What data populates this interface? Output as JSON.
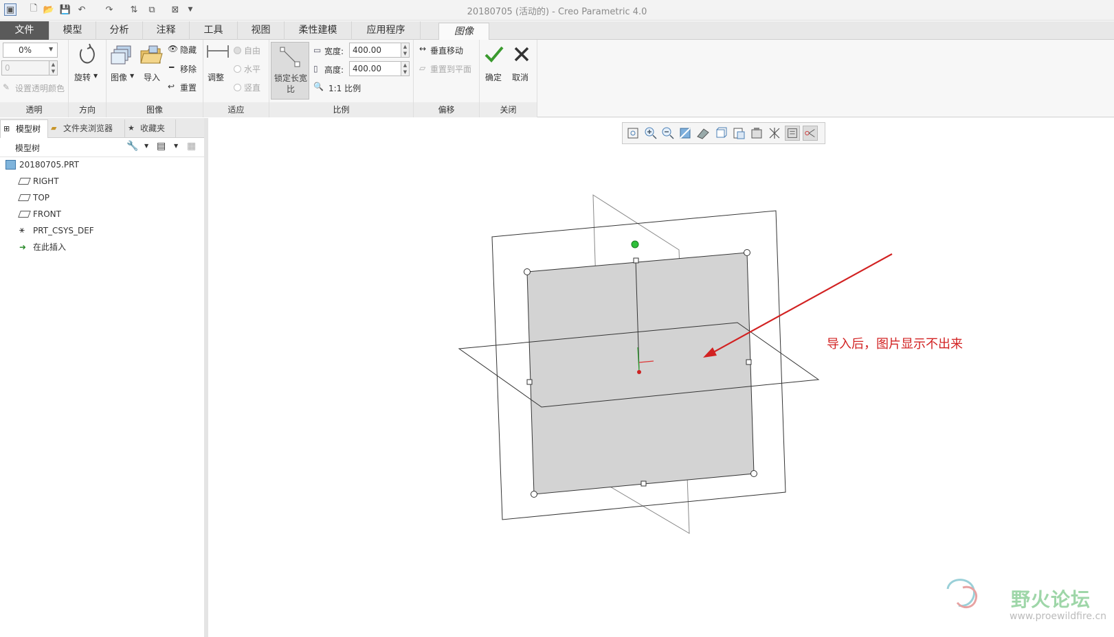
{
  "window": {
    "title": "20180705 (活动的) - Creo Parametric 4.0"
  },
  "ribbon_tabs": [
    {
      "label": "文件"
    },
    {
      "label": "模型"
    },
    {
      "label": "分析"
    },
    {
      "label": "注释"
    },
    {
      "label": "工具"
    },
    {
      "label": "视图"
    },
    {
      "label": "柔性建模"
    },
    {
      "label": "应用程序"
    },
    {
      "label": "图像"
    }
  ],
  "ribbon": {
    "transparency": {
      "value": "0%",
      "second_value": "0",
      "set_color": "设置透明颜色",
      "label": "透明"
    },
    "direction": {
      "rotate": "旋转",
      "label": "方向"
    },
    "image": {
      "image": "图像",
      "import": "导入",
      "hide": "隐藏",
      "remove": "移除",
      "reset": "重置",
      "label": "图像"
    },
    "fit": {
      "adjust": "调整",
      "free": "自由",
      "horizontal": "水平",
      "vertical": "竖直",
      "label": "适应"
    },
    "scale": {
      "lock_aspect": "锁定长宽比",
      "width_label": "宽度:",
      "width_value": "400.00",
      "height_label": "高度:",
      "height_value": "400.00",
      "one_to_one": "1:1 比例",
      "label": "比例"
    },
    "offset": {
      "vertical_move": "垂直移动",
      "reset_to_plane": "重置到平面",
      "label": "偏移"
    },
    "close": {
      "ok": "确定",
      "cancel": "取消",
      "label": "关闭"
    }
  },
  "panel": {
    "tabs": [
      {
        "label": "模型树"
      },
      {
        "label": "文件夹浏览器"
      },
      {
        "label": "收藏夹"
      }
    ],
    "header": "模型树",
    "tree": [
      {
        "label": "20180705.PRT"
      },
      {
        "label": "RIGHT"
      },
      {
        "label": "TOP"
      },
      {
        "label": "FRONT"
      },
      {
        "label": "PRT_CSYS_DEF"
      },
      {
        "label": "在此插入"
      }
    ]
  },
  "graphics": {
    "annotation": "导入后，图片显示不出来",
    "annotation_color": "#d22222"
  },
  "watermark": {
    "name": "野火论坛",
    "url": "www.proewildfire.cn"
  }
}
